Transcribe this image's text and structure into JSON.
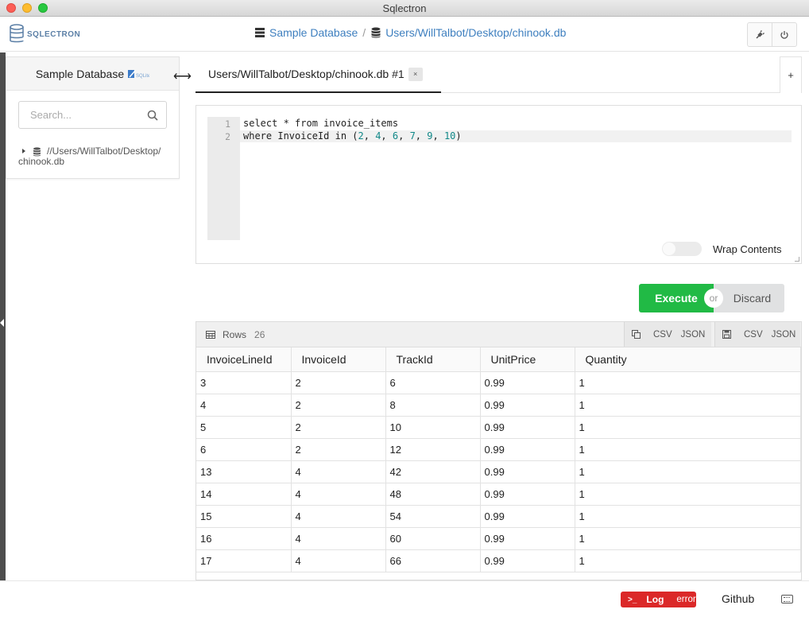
{
  "window": {
    "title": "Sqlectron"
  },
  "header": {
    "logo_text": "SQLECTRON",
    "breadcrumb": {
      "database": "Sample Database",
      "path": "Users/WillTalbot/Desktop/chinook.db"
    }
  },
  "sidebar": {
    "title": "Sample Database",
    "search_placeholder": "Search...",
    "tree_item_line1": "//Users/WillTalbot/Desktop/",
    "tree_item_line2": "chinook.db"
  },
  "tabs": [
    {
      "label": "Users/WillTalbot/Desktop/chinook.db #1",
      "close": "×"
    }
  ],
  "tab_add": "+",
  "editor": {
    "line_numbers": [
      "1",
      "2"
    ],
    "line1": "select * from invoice_items",
    "line2_prefix": "where InvoiceId in (",
    "line2_numbers": [
      "2",
      "4",
      "6",
      "7",
      "9",
      "10"
    ],
    "line2_suffix": ")",
    "wrap_label": "Wrap Contents"
  },
  "actions": {
    "execute": "Execute",
    "or": "or",
    "discard": "Discard"
  },
  "results": {
    "rows_label": "Rows",
    "rows_count": "26",
    "export": {
      "csv": "CSV",
      "json": "JSON"
    },
    "columns": [
      "InvoiceLineId",
      "InvoiceId",
      "TrackId",
      "UnitPrice",
      "Quantity"
    ],
    "rows": [
      [
        "3",
        "2",
        "6",
        "0.99",
        "1"
      ],
      [
        "4",
        "2",
        "8",
        "0.99",
        "1"
      ],
      [
        "5",
        "2",
        "10",
        "0.99",
        "1"
      ],
      [
        "6",
        "2",
        "12",
        "0.99",
        "1"
      ],
      [
        "13",
        "4",
        "42",
        "0.99",
        "1"
      ],
      [
        "14",
        "4",
        "48",
        "0.99",
        "1"
      ],
      [
        "15",
        "4",
        "54",
        "0.99",
        "1"
      ],
      [
        "16",
        "4",
        "60",
        "0.99",
        "1"
      ],
      [
        "17",
        "4",
        "66",
        "0.99",
        "1"
      ]
    ]
  },
  "footer": {
    "log_label": "Log",
    "log_status": "error",
    "log_prompt": ">_",
    "github": "Github"
  },
  "colors": {
    "accent": "#3e7fbf",
    "execute": "#21ba45",
    "error": "#db2828"
  }
}
